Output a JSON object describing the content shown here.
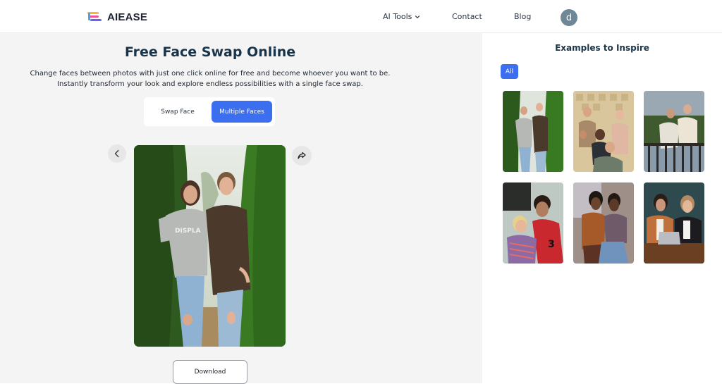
{
  "header": {
    "logo_text": "AIEASE",
    "nav": {
      "ai_tools": "AI Tools",
      "contact": "Contact",
      "blog": "Blog"
    },
    "avatar_initial": "d"
  },
  "main": {
    "title": "Free Face Swap Online",
    "subtitle": "Change faces between photos with just one click online for free and become whoever you want to be. Instantly transform your look and explore endless possibilities with a single face swap.",
    "modes": [
      {
        "label": "Swap Face",
        "active": false
      },
      {
        "label": "Multiple Faces",
        "active": true
      }
    ],
    "download_label": "Download",
    "accent_color": "#3c6ff0"
  },
  "sidebar": {
    "title": "Examples to Inspire",
    "filter_all": "All",
    "examples": [
      {
        "description": "Two women in t-shirts standing between green hedges"
      },
      {
        "description": "Group of friends celebrating in front of patterned wall"
      },
      {
        "description": "Two men leaning on a railing outdoors"
      },
      {
        "description": "Couple hugging, man in red jersey number 3"
      },
      {
        "description": "Two people sitting together, one in brown jacket"
      },
      {
        "description": "Two women at a table with a laptop"
      }
    ]
  }
}
